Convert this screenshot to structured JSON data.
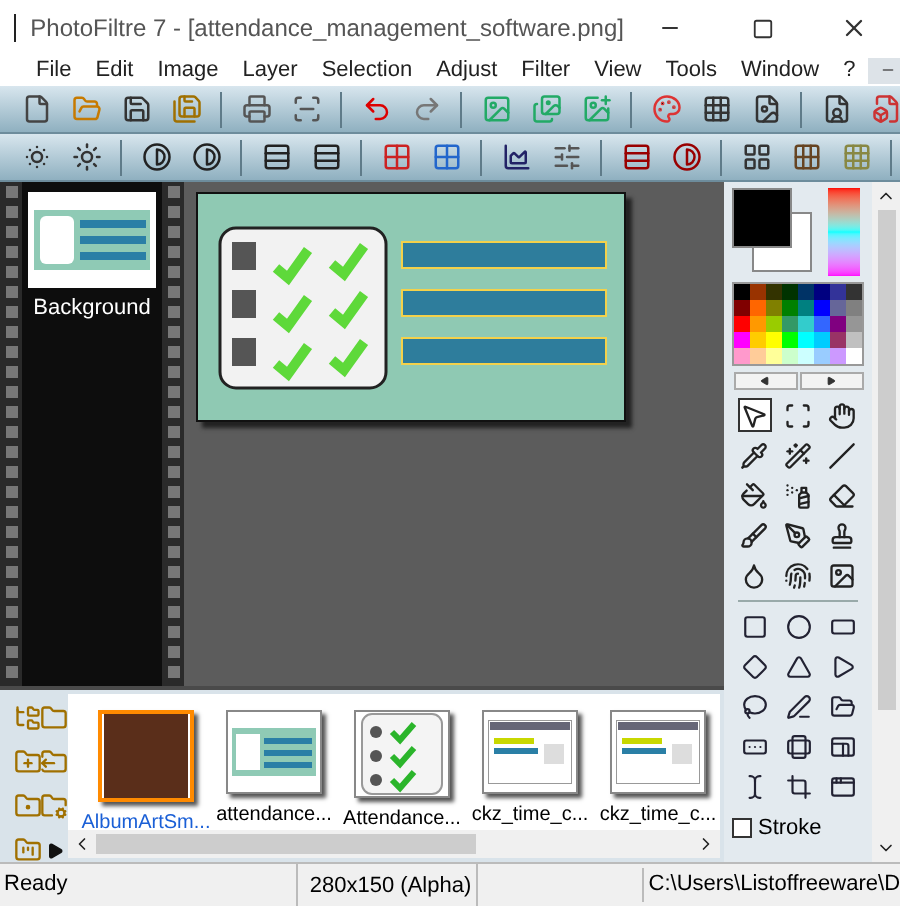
{
  "window": {
    "title": "PhotoFiltre 7 - [attendance_management_software.png]"
  },
  "menu": [
    "File",
    "Edit",
    "Image",
    "Layer",
    "Selection",
    "Adjust",
    "Filter",
    "View",
    "Tools",
    "Window",
    "?"
  ],
  "layers": [
    {
      "label": "Background",
      "selected": true
    }
  ],
  "palette": [
    {
      "color": "#000000"
    },
    {
      "color": "#993300"
    },
    {
      "color": "#333300"
    },
    {
      "color": "#003300"
    },
    {
      "color": "#003366"
    },
    {
      "color": "#000080"
    },
    {
      "color": "#333399"
    },
    {
      "color": "#333333"
    },
    {
      "color": "#800000"
    },
    {
      "color": "#ff6600"
    },
    {
      "color": "#808000"
    },
    {
      "color": "#008000"
    },
    {
      "color": "#008080"
    },
    {
      "color": "#0000ff"
    },
    {
      "color": "#666699"
    },
    {
      "color": "#808080"
    },
    {
      "color": "#ff0000"
    },
    {
      "color": "#ff9900"
    },
    {
      "color": "#99cc00"
    },
    {
      "color": "#339966"
    },
    {
      "color": "#33cccc"
    },
    {
      "color": "#3366ff"
    },
    {
      "color": "#800080"
    },
    {
      "color": "#969696"
    },
    {
      "color": "#ff00ff"
    },
    {
      "color": "#ffcc00"
    },
    {
      "color": "#ffff00"
    },
    {
      "color": "#00ff00"
    },
    {
      "color": "#00ffff"
    },
    {
      "color": "#00ccff"
    },
    {
      "color": "#993366"
    },
    {
      "color": "#c0c0c0"
    },
    {
      "color": "#ff99cc"
    },
    {
      "color": "#ffcc99"
    },
    {
      "color": "#ffff99"
    },
    {
      "color": "#ccffcc"
    },
    {
      "color": "#ccffff"
    },
    {
      "color": "#99ccff"
    },
    {
      "color": "#cc99ff"
    },
    {
      "color": "#ffffff"
    }
  ],
  "tools": [
    {
      "selected": true
    },
    {
      "selected": false
    },
    {
      "selected": false
    },
    {
      "selected": false
    },
    {
      "selected": false
    },
    {
      "selected": false
    },
    {
      "selected": false
    },
    {
      "selected": false
    },
    {
      "selected": false
    },
    {
      "selected": false
    },
    {
      "selected": false
    },
    {
      "selected": false
    },
    {
      "selected": false
    },
    {
      "selected": false
    },
    {
      "selected": false
    }
  ],
  "options": [
    {
      "label": "Stroke",
      "checked": false
    }
  ],
  "files": [
    {
      "name": "AlbumArtSm...",
      "kind": "photo",
      "selected": true
    },
    {
      "name": "attendance...",
      "kind": "banner",
      "selected": false
    },
    {
      "name": "Attendance...",
      "kind": "checklist",
      "selected": false
    },
    {
      "name": "ckz_time_c...",
      "kind": "screen",
      "selected": false
    },
    {
      "name": "ckz_time_c...",
      "kind": "screen",
      "selected": false
    }
  ],
  "status_bar": {
    "message": "Ready",
    "size": "280x150 (Alpha)",
    "path": "C:\\Users\\Listoffreeware\\D"
  }
}
